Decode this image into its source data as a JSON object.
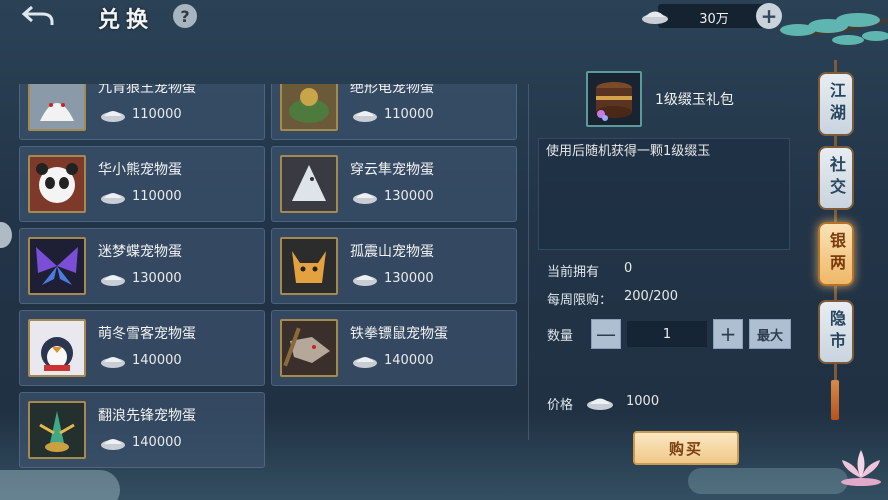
{
  "header": {
    "title": "兑换",
    "help_label": "?",
    "currency_value": "30万",
    "add_label": "+"
  },
  "items": [
    {
      "name": "九肯狼王宠物蛋",
      "price": "110000",
      "icon": "white-wolf-portrait"
    },
    {
      "name": "绝形龟宠物蛋",
      "price": "110000",
      "icon": "turtle-dragon-portrait"
    },
    {
      "name": "华小熊宠物蛋",
      "price": "110000",
      "icon": "panda-portrait"
    },
    {
      "name": "穿云隼宠物蛋",
      "price": "130000",
      "icon": "white-falcon-portrait"
    },
    {
      "name": "迷梦蝶宠物蛋",
      "price": "130000",
      "icon": "purple-butterfly-portrait"
    },
    {
      "name": "孤震山宠物蛋",
      "price": "130000",
      "icon": "fox-warrior-portrait"
    },
    {
      "name": "萌冬雪客宠物蛋",
      "price": "140000",
      "icon": "penguin-portrait"
    },
    {
      "name": "铁拳镖鼠宠物蛋",
      "price": "140000",
      "icon": "rat-warrior-portrait"
    },
    {
      "name": "翻浪先锋宠物蛋",
      "price": "140000",
      "icon": "mantis-portrait"
    }
  ],
  "detail": {
    "name": "1级缀玉礼包",
    "description": "使用后随机获得一颗1级缀玉",
    "owned_label": "当前拥有",
    "owned_value": "0",
    "limit_label": "每周限购：",
    "limit_value": "200/200",
    "quantity_label": "数量",
    "minus_label": "—",
    "quantity_value": "1",
    "plus_label": "+",
    "max_label": "最大",
    "price_label": "价格",
    "price_value": "1000",
    "buy_label": "购买"
  },
  "side_tabs": [
    {
      "label": "江湖",
      "active": false
    },
    {
      "label": "社交",
      "active": false
    },
    {
      "label": "银两",
      "active": true
    },
    {
      "label": "隐市",
      "active": false
    }
  ],
  "colors": {
    "card_bg": "#3c526c",
    "icon_border": "#a58a4f",
    "active_tab": "#eeb868",
    "buy_button": "#f0c98a"
  }
}
